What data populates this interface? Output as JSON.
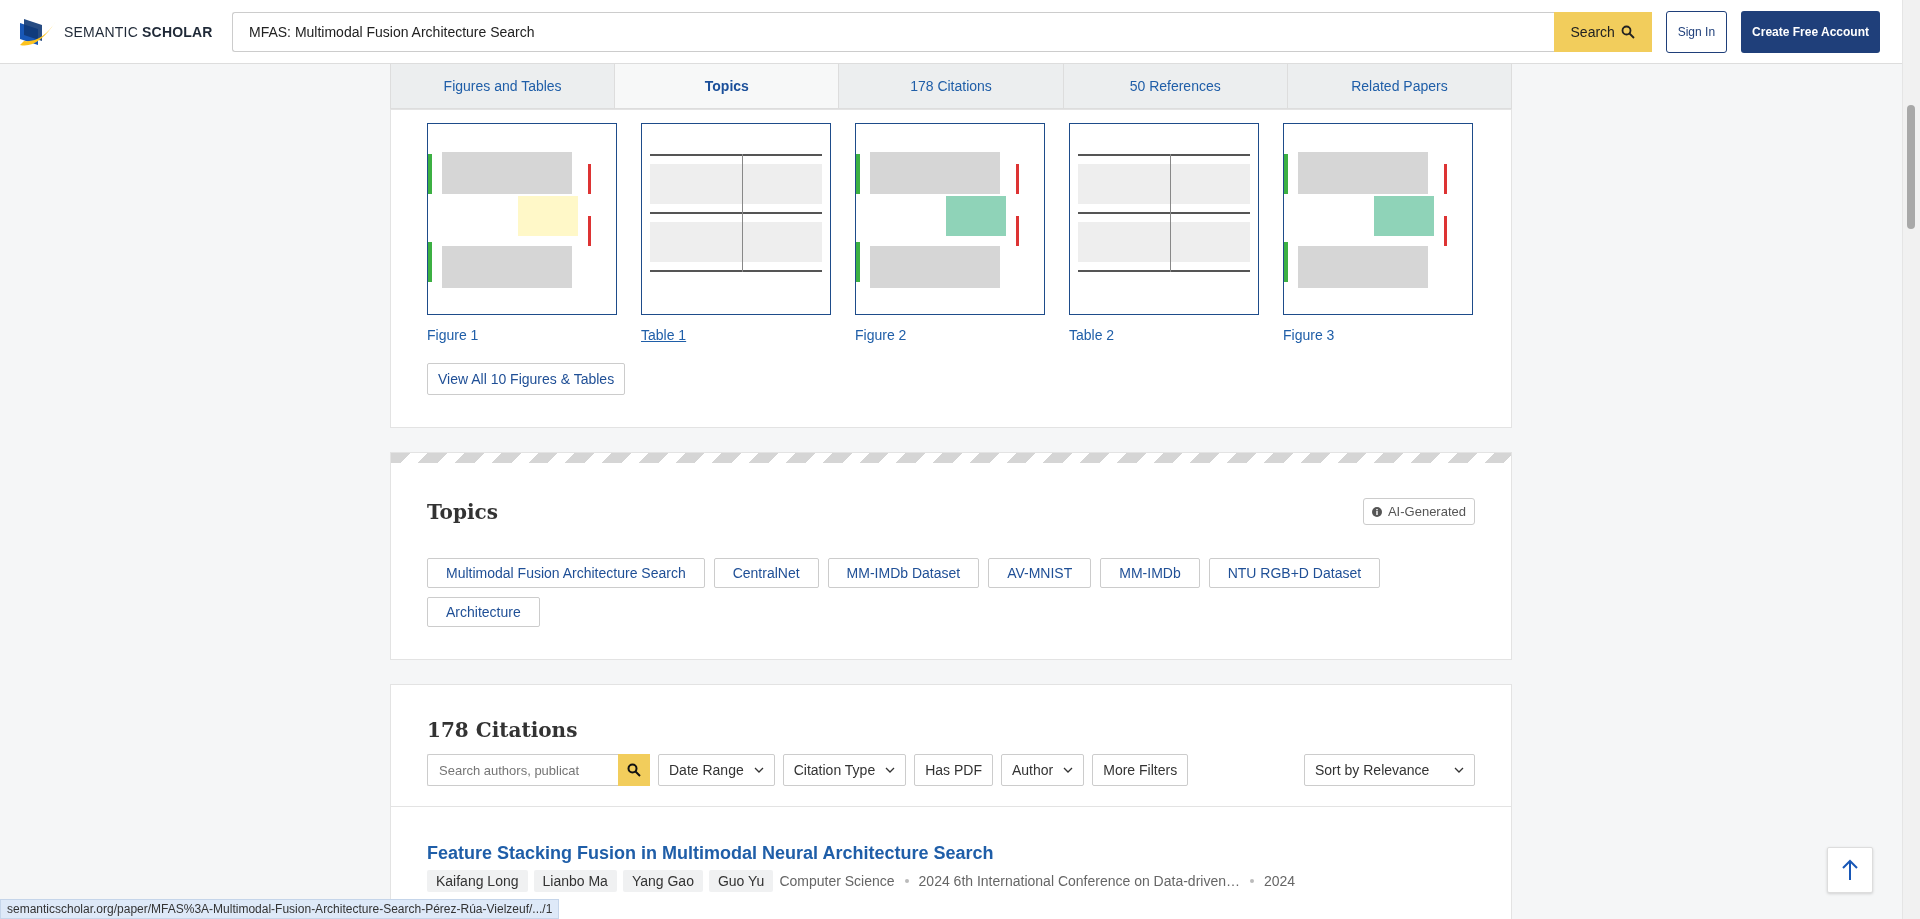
{
  "header": {
    "logo_text": "SEMANTIC",
    "logo_bold": "SCHOLAR",
    "search": {
      "value": "MFAS: Multimodal Fusion Architecture Search",
      "button": "Search"
    },
    "sign_in": "Sign In",
    "create_account": "Create Free Account"
  },
  "tabs": [
    {
      "label": "Figures and Tables",
      "selected": false
    },
    {
      "label": "Topics",
      "selected": true
    },
    {
      "label": "178 Citations",
      "selected": false
    },
    {
      "label": "50 References",
      "selected": false
    },
    {
      "label": "Related Papers",
      "selected": false
    }
  ],
  "figures": {
    "items": [
      {
        "label": "Figure 1",
        "hovered": false,
        "kind": "picture"
      },
      {
        "label": "Table 1",
        "hovered": true,
        "kind": "picture"
      },
      {
        "label": "Figure 2",
        "hovered": false,
        "kind": "picture"
      },
      {
        "label": "Table 2",
        "hovered": false,
        "kind": "picture"
      },
      {
        "label": "Figure 3",
        "hovered": false,
        "kind": "picture"
      }
    ],
    "view_all": "View All 10 Figures & Tables"
  },
  "topics": {
    "title": "Topics",
    "badge": "AI-Generated",
    "items": [
      "Multimodal Fusion Architecture Search",
      "CentralNet",
      "MM-IMDb Dataset",
      "AV-MNIST",
      "MM-IMDb",
      "NTU RGB+D Dataset",
      "Architecture"
    ]
  },
  "citations": {
    "title": "178 Citations",
    "search": {
      "placeholder": "Search authors, publicat"
    },
    "filters": [
      {
        "label": "Date Range",
        "kind": "dropdown"
      },
      {
        "label": "Citation Type",
        "kind": "dropdown"
      },
      {
        "label": "Has PDF",
        "kind": "toggle"
      },
      {
        "label": "Author",
        "kind": "dropdown"
      },
      {
        "label": "More Filters",
        "kind": "toggle"
      }
    ],
    "sort": "Sort by Relevance",
    "papers": [
      {
        "title": "Feature Stacking Fusion in Multimodal Neural Architecture Search",
        "authors": [
          "Kaifang Long",
          "Lianbo Ma",
          "Yang Gao",
          "Guo Yu"
        ],
        "field": "Computer Science",
        "venue": "2024 6th International Conference on Data-driven…",
        "year": "2024"
      }
    ]
  },
  "status_bar": "semanticscholar.org/paper/MFAS%3A-Multimodal-Fusion-Architecture-Search-Pérez-Rúa-Vielzeuf/.../1"
}
